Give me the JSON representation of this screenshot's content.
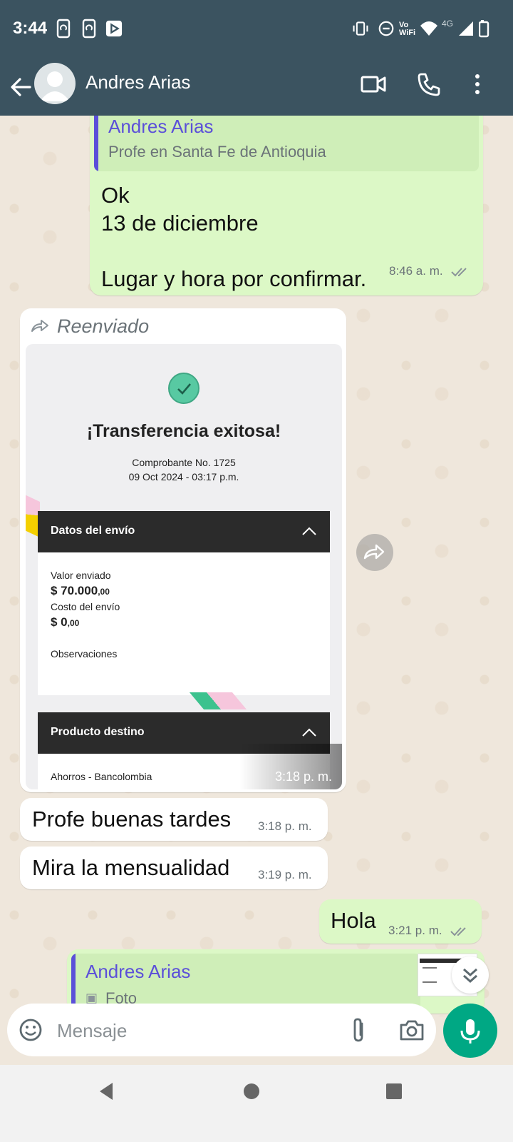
{
  "status_bar": {
    "time": "3:44",
    "network": "4G",
    "vowifi": "Vo WiFi"
  },
  "header": {
    "contact_name": "Andres Arias"
  },
  "messages": [
    {
      "quote_name": "Andres Arias",
      "quote_text": "Profe en Santa Fe de Antioquia",
      "text": "Ok\n13 de diciembre\n\nLugar y hora por confirmar.",
      "time": "8:46 a. m."
    },
    {
      "forwarded_label": "Reenviado",
      "time": "3:18 p. m.",
      "receipt": {
        "title": "¡Transferencia exitosa!",
        "voucher": "Comprobante No. 1725",
        "datetime": "09 Oct 2024 - 03:17 p.m.",
        "section1_title": "Datos del envío",
        "sent_label": "Valor enviado",
        "sent_value": "$ 70.000",
        "sent_cents": ",00",
        "fee_label": "Costo del envío",
        "fee_value": "$ 0",
        "fee_cents": ",00",
        "notes_label": "Observaciones",
        "section2_title": "Producto destino",
        "product": "Ahorros - Bancolombia"
      }
    },
    {
      "text": "Profe buenas tardes",
      "time": "3:18 p. m."
    },
    {
      "text": "Mira la mensualidad",
      "time": "3:19 p. m."
    },
    {
      "text": "Hola",
      "time": "3:21 p. m."
    },
    {
      "quote_name": "Andres Arias",
      "quote_text": "Foto"
    }
  ],
  "composer": {
    "placeholder": "Mensaje"
  },
  "colors": {
    "header": "#3b5360",
    "outgoing": "#dcf8c6",
    "accent": "#00a884"
  }
}
